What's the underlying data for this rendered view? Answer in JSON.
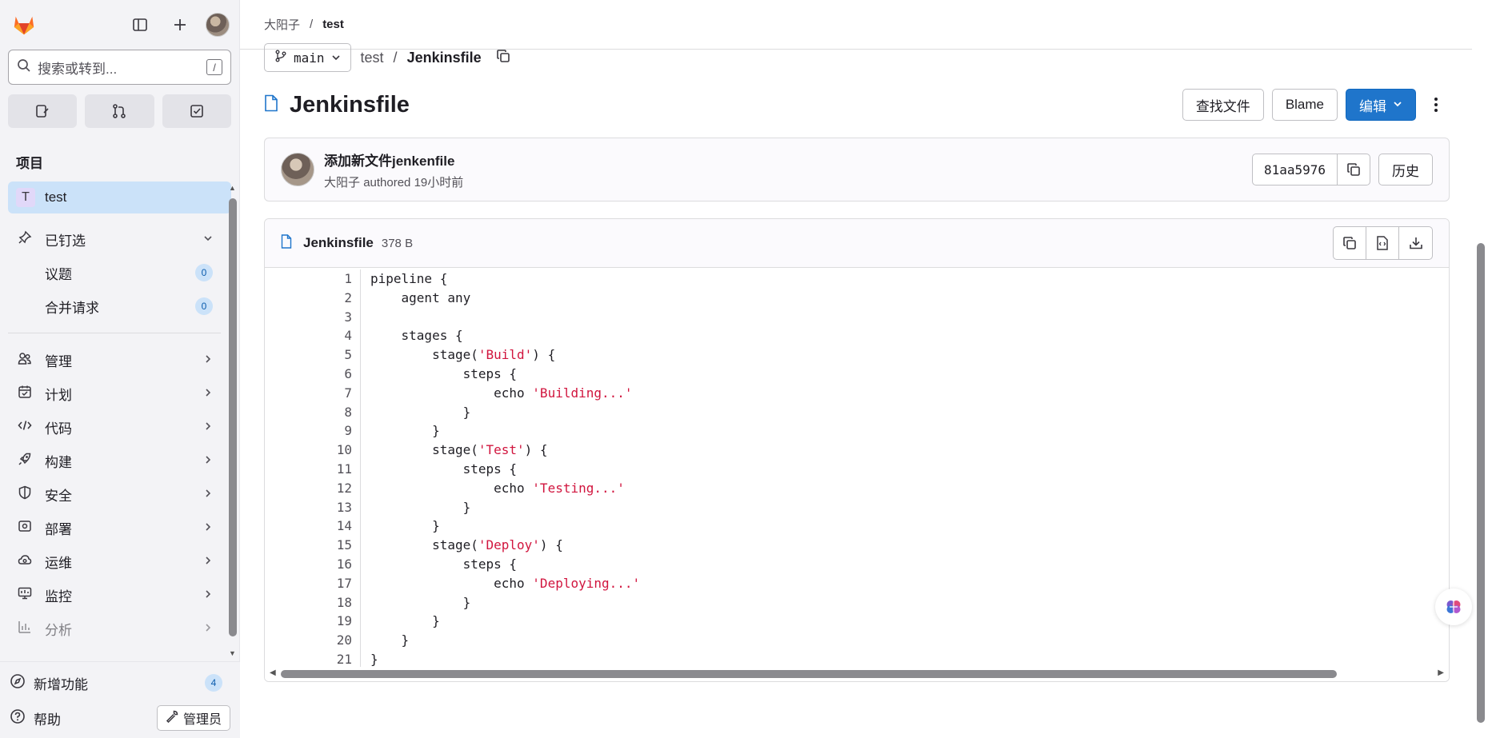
{
  "sidebar": {
    "search_placeholder": "搜索或转到...",
    "search_shortcut": "/",
    "project_section_title": "项目",
    "project": {
      "letter": "T",
      "name": "test"
    },
    "pinned": {
      "label": "已钉选",
      "items": [
        {
          "label": "议题",
          "count": "0"
        },
        {
          "label": "合并请求",
          "count": "0"
        }
      ]
    },
    "nav": [
      {
        "label": "管理",
        "icon": "users-icon"
      },
      {
        "label": "计划",
        "icon": "calendar-icon"
      },
      {
        "label": "代码",
        "icon": "code-icon"
      },
      {
        "label": "构建",
        "icon": "rocket-icon"
      },
      {
        "label": "安全",
        "icon": "shield-icon"
      },
      {
        "label": "部署",
        "icon": "deploy-icon"
      },
      {
        "label": "运维",
        "icon": "cloud-gear-icon"
      },
      {
        "label": "监控",
        "icon": "monitor-icon"
      },
      {
        "label": "分析",
        "icon": "chart-icon"
      }
    ],
    "whats_new": {
      "label": "新增功能",
      "count": "4"
    },
    "help": "帮助",
    "admin": "管理员"
  },
  "breadcrumb": {
    "user": "大阳子",
    "separator": "/",
    "project": "test"
  },
  "path": {
    "branch": "main",
    "dir": "test",
    "separator": "/",
    "file": "Jenkinsfile"
  },
  "title": "Jenkinsfile",
  "actions": {
    "find_file": "查找文件",
    "blame": "Blame",
    "edit": "编辑"
  },
  "commit": {
    "title": "添加新文件jenkenfile",
    "author": "大阳子",
    "authored_text": "authored 19小时前",
    "sha": "81aa5976",
    "history": "历史"
  },
  "file": {
    "name": "Jenkinsfile",
    "size": "378 B",
    "lines": [
      "pipeline {",
      "    agent any",
      "",
      "    stages {",
      "        stage('Build') {",
      "            steps {",
      "                echo 'Building...'",
      "            }",
      "        }",
      "        stage('Test') {",
      "            steps {",
      "                echo 'Testing...'",
      "            }",
      "        }",
      "        stage('Deploy') {",
      "            steps {",
      "                echo 'Deploying...'",
      "            }",
      "        }",
      "    }",
      "}"
    ]
  },
  "colors": {
    "primary": "#1f75cb",
    "active_item": "#cbe2f9",
    "string": "#d1153e",
    "logo": "#e24329"
  }
}
